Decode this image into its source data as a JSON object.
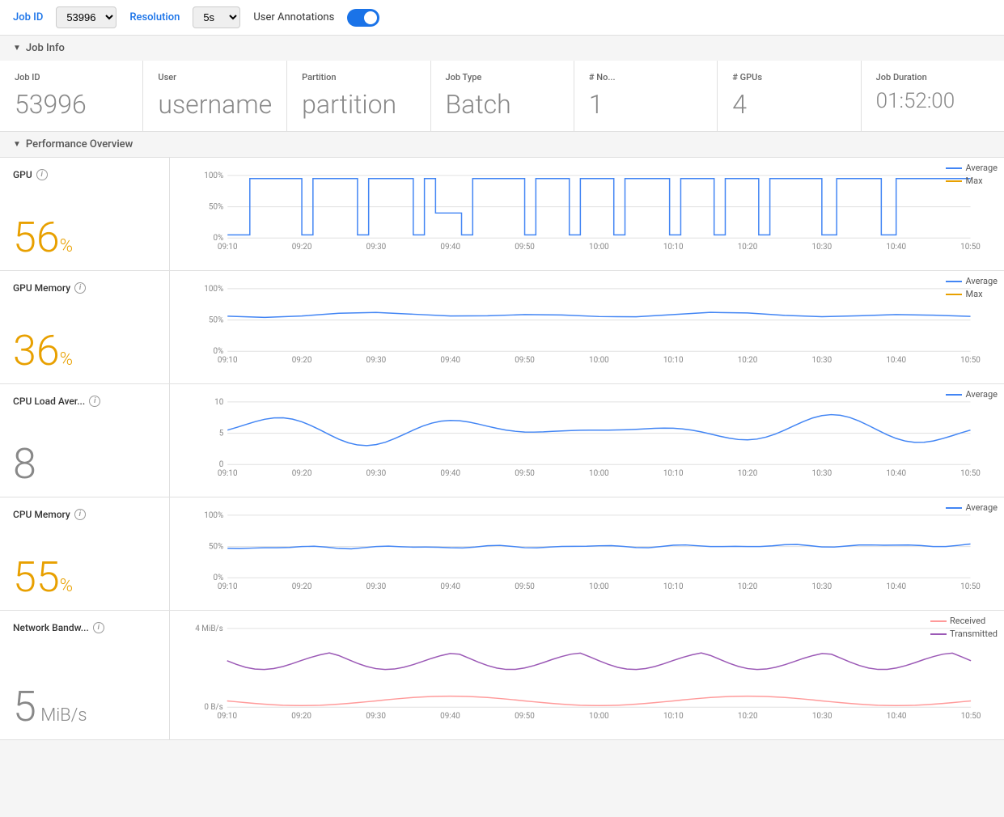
{
  "topbar": {
    "job_id_label": "Job ID",
    "job_id_value": "53996",
    "resolution_label": "Resolution",
    "resolution_value": "5s",
    "annotations_label": "User Annotations"
  },
  "job_info_section": "Job Info",
  "perf_section": "Performance Overview",
  "info_cards": [
    {
      "label": "Job ID",
      "value": "53996"
    },
    {
      "label": "User",
      "value": "username"
    },
    {
      "label": "Partition",
      "value": "partition"
    },
    {
      "label": "Job Type",
      "value": "Batch"
    },
    {
      "label": "# No...",
      "value": "1"
    },
    {
      "label": "# GPUs",
      "value": "4"
    },
    {
      "label": "Job Duration",
      "value": "01:52:00"
    }
  ],
  "metrics": [
    {
      "title": "GPU",
      "value": "56",
      "unit": "%",
      "value_class": "gold",
      "legend": [
        {
          "label": "Average",
          "color": "#4285f4"
        },
        {
          "label": "Max",
          "color": "#e8a000"
        }
      ],
      "y_labels": [
        "100%",
        "50%",
        "0%"
      ],
      "x_labels": [
        "09:10",
        "09:20",
        "09:30",
        "09:40",
        "09:50",
        "10:00",
        "10:10",
        "10:20",
        "10:30",
        "10:40",
        "10:50"
      ],
      "chart_type": "gpu"
    },
    {
      "title": "GPU Memory",
      "value": "36",
      "unit": "%",
      "value_class": "gold",
      "legend": [
        {
          "label": "Average",
          "color": "#4285f4"
        },
        {
          "label": "Max",
          "color": "#e8a000"
        }
      ],
      "y_labels": [
        "100%",
        "50%",
        "0%"
      ],
      "x_labels": [
        "09:10",
        "09:20",
        "09:30",
        "09:40",
        "09:50",
        "10:00",
        "10:10",
        "10:20",
        "10:30",
        "10:40",
        "10:50"
      ],
      "chart_type": "gpu_memory"
    },
    {
      "title": "CPU Load Aver...",
      "value": "8",
      "unit": "",
      "value_class": "grey",
      "legend": [
        {
          "label": "Average",
          "color": "#4285f4"
        }
      ],
      "y_labels": [
        "10",
        "5",
        "0"
      ],
      "x_labels": [
        "09:10",
        "09:20",
        "09:30",
        "09:40",
        "09:50",
        "10:00",
        "10:10",
        "10:20",
        "10:30",
        "10:40",
        "10:50"
      ],
      "chart_type": "cpu_load"
    },
    {
      "title": "CPU Memory",
      "value": "55",
      "unit": "%",
      "value_class": "gold",
      "legend": [
        {
          "label": "Average",
          "color": "#4285f4"
        }
      ],
      "y_labels": [
        "100%",
        "50%",
        "0%"
      ],
      "x_labels": [
        "09:10",
        "09:20",
        "09:30",
        "09:40",
        "09:50",
        "10:00",
        "10:10",
        "10:20",
        "10:30",
        "10:40",
        "10:50"
      ],
      "chart_type": "cpu_memory"
    },
    {
      "title": "Network Bandw...",
      "value": "5",
      "unit": " MiB/s",
      "value_class": "grey",
      "legend": [
        {
          "label": "Received",
          "color": "#ff9a9a"
        },
        {
          "label": "Transmitted",
          "color": "#9b59b6"
        }
      ],
      "y_labels": [
        "4 MiB/s",
        "0 B/s"
      ],
      "x_labels": [
        "09:10",
        "09:20",
        "09:30",
        "09:40",
        "09:50",
        "10:00",
        "10:10",
        "10:20",
        "10:30",
        "10:40",
        "10:50"
      ],
      "chart_type": "network"
    }
  ],
  "colors": {
    "blue": "#4285f4",
    "gold": "#e8a000",
    "grey": "#888888",
    "purple": "#9b59b6",
    "pink": "#ff9a9a",
    "accent": "#1a73e8"
  }
}
